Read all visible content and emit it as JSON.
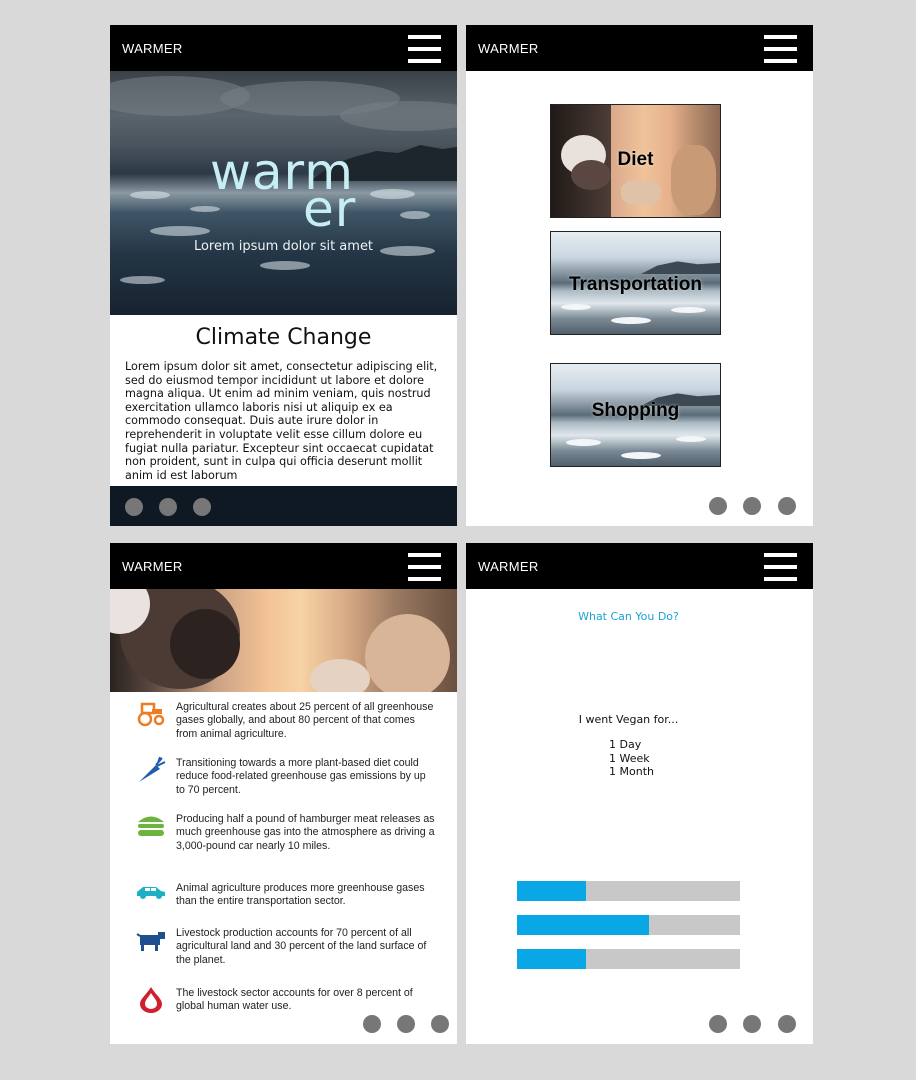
{
  "panels": {
    "p1": {
      "brand": "WARMER",
      "hero": {
        "logo_line1": "warm",
        "logo_line2": "er",
        "subtitle": "Lorem ipsum dolor sit amet"
      },
      "title": "Climate Change",
      "body": "Lorem ipsum dolor sit amet, consectetur adipiscing elit, sed do eiusmod tempor incididunt ut labore et dolore magna aliqua. Ut enim ad minim veniam, quis nostrud exercitation ullamco laboris nisi ut aliquip ex ea commodo consequat. Duis aute irure dolor in reprehenderit in voluptate velit esse cillum dolore eu fugiat nulla pariatur. Excepteur sint occaecat cupidatat non proident, sunt in culpa qui officia deserunt mollit anim id est laborum"
    },
    "p2": {
      "brand": "WARMER",
      "categories": [
        "Diet",
        "Transportation",
        "Shopping"
      ]
    },
    "p3": {
      "brand": "WARMER",
      "facts": [
        {
          "icon": "tractor-icon",
          "color": "#f07c21",
          "text": "Agricultural creates about 25 percent of all greenhouse gases globally, and about 80 percent of that comes from animal agriculture."
        },
        {
          "icon": "carrot-icon",
          "color": "#1f5fa8",
          "text": "Transitioning towards a more plant-based diet could reduce food-related greenhouse gas emissions by up to 70 percent."
        },
        {
          "icon": "burger-icon",
          "color": "#6cb33f",
          "text": "Producing half a pound of hamburger meat releases as much greenhouse gas into the atmosphere as driving a 3,000-pound car nearly 10 miles."
        },
        {
          "icon": "car-icon",
          "color": "#1cb0c6",
          "text": "Animal agriculture produces more greenhouse gases than the entire transportation sector."
        },
        {
          "icon": "cow-icon",
          "color": "#1f4f8f",
          "text": "Livestock production accounts for 70 percent of all agricultural land and 30 percent of the land surface of the planet."
        },
        {
          "icon": "water-drop-icon",
          "color": "#d0202f",
          "text": "The livestock sector accounts for over 8 percent of global human water use."
        }
      ]
    },
    "p4": {
      "brand": "WARMER",
      "title": "What Can You Do?",
      "question": "I went Vegan for...",
      "options": [
        "1 Day",
        "1 Week",
        "1 Month"
      ],
      "progress": [
        0.31,
        0.59,
        0.31
      ],
      "colors": {
        "fill": "#0aa7e6",
        "track": "#c8c8c8"
      }
    }
  }
}
